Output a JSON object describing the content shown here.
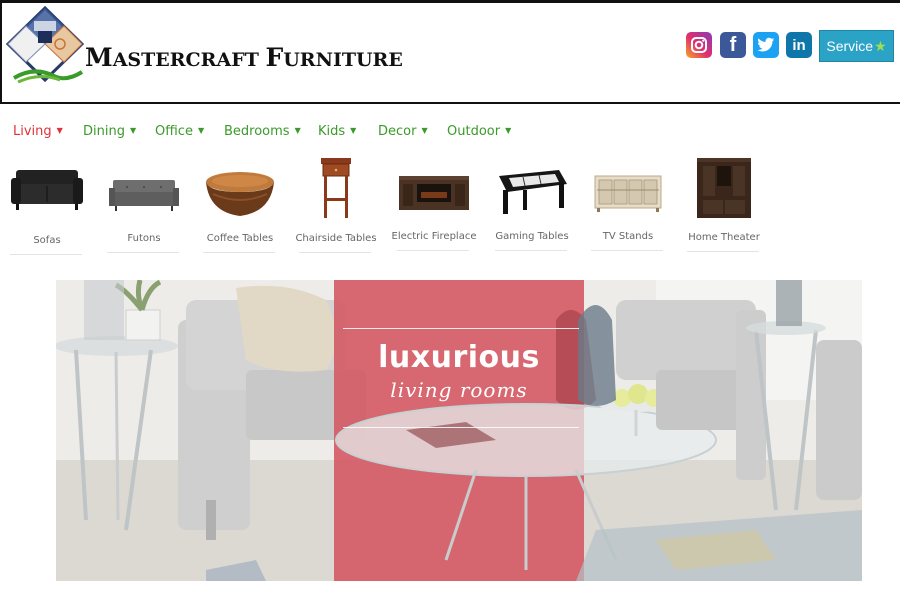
{
  "brand": {
    "name_initial_1": "M",
    "name_rest_1": "ASTERCRAFT ",
    "name_initial_2": "F",
    "name_rest_2": "URNITURE"
  },
  "header": {
    "social": [
      {
        "name": "instagram",
        "glyph": ""
      },
      {
        "name": "facebook",
        "glyph": "f"
      },
      {
        "name": "twitter",
        "glyph": ""
      },
      {
        "name": "linkedin",
        "glyph": "in"
      }
    ],
    "service_label": "Service",
    "service_icon": "star-icon"
  },
  "nav": {
    "items": [
      {
        "label": "Living",
        "active": true
      },
      {
        "label": "Dining",
        "active": false
      },
      {
        "label": "Office",
        "active": false
      },
      {
        "label": "Bedrooms",
        "active": false
      },
      {
        "label": "Kids",
        "active": false
      },
      {
        "label": "Decor",
        "active": false
      },
      {
        "label": "Outdoor",
        "active": false
      }
    ]
  },
  "categories": [
    {
      "label": "Sofas",
      "icon": "sofa-icon"
    },
    {
      "label": "Futons",
      "icon": "futon-icon"
    },
    {
      "label": "Coffee Tables",
      "icon": "coffee-table-icon"
    },
    {
      "label": "Chairside Tables",
      "icon": "chairside-table-icon"
    },
    {
      "label": "Electric Fireplace",
      "icon": "fireplace-icon"
    },
    {
      "label": "Gaming Tables",
      "icon": "gaming-table-icon"
    },
    {
      "label": "TV Stands",
      "icon": "tv-stand-icon"
    },
    {
      "label": "Home Theater",
      "icon": "home-theater-icon"
    }
  ],
  "hero": {
    "line1": "luxurious",
    "line2": "living rooms"
  },
  "colors": {
    "nav_active": "#e0323a",
    "nav_default": "#3a9a2a",
    "service_button": "#2ba3c7",
    "hero_overlay": "#d45a64"
  }
}
